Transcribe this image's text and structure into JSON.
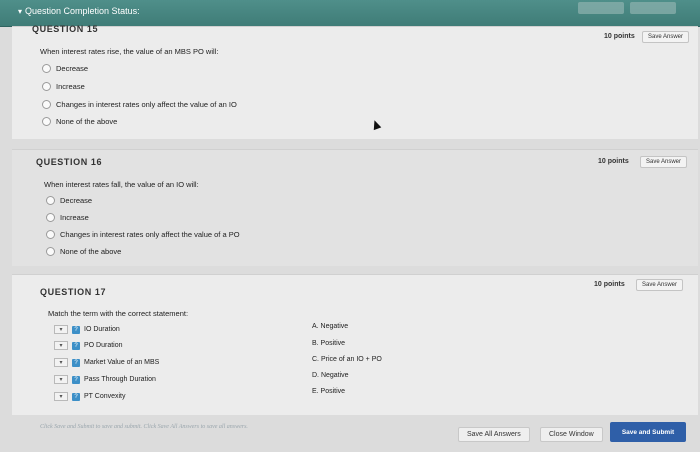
{
  "header": {
    "status_label": "Question Completion Status:",
    "arrow_icon": "triangle-down-icon"
  },
  "questions": [
    {
      "title": "QUESTION 15",
      "points": "10 points",
      "save_label": "Save Answer",
      "prompt": "When interest rates rise, the value of an MBS PO will:",
      "options": [
        "Decrease",
        "Increase",
        "Changes in interest rates only affect the value of an IO",
        "None of the above"
      ]
    },
    {
      "title": "QUESTION 16",
      "points": "10 points",
      "save_label": "Save Answer",
      "prompt": "When interest rates fall, the value of an IO will:",
      "options": [
        "Decrease",
        "Increase",
        "Changes in interest rates only affect the value of a PO",
        "None of the above"
      ]
    },
    {
      "title": "QUESTION 17",
      "points": "10 points",
      "save_label": "Save Answer",
      "prompt": "Match the term with the correct statement:",
      "terms": [
        "IO Duration",
        "PO Duration",
        "Market Value of an MBS",
        "Pass Through Duration",
        "PT Convexity"
      ],
      "answers": [
        "A. Negative",
        "B. Positive",
        "C. Price of an IO + PO",
        "D. Negative",
        "E. Positive"
      ]
    }
  ],
  "footer": {
    "note": "Click Save and Submit to save and submit. Click Save All Answers to save all answers.",
    "save_all": "Save All Answers",
    "close_window": "Close Window",
    "save_submit": "Save and Submit"
  }
}
